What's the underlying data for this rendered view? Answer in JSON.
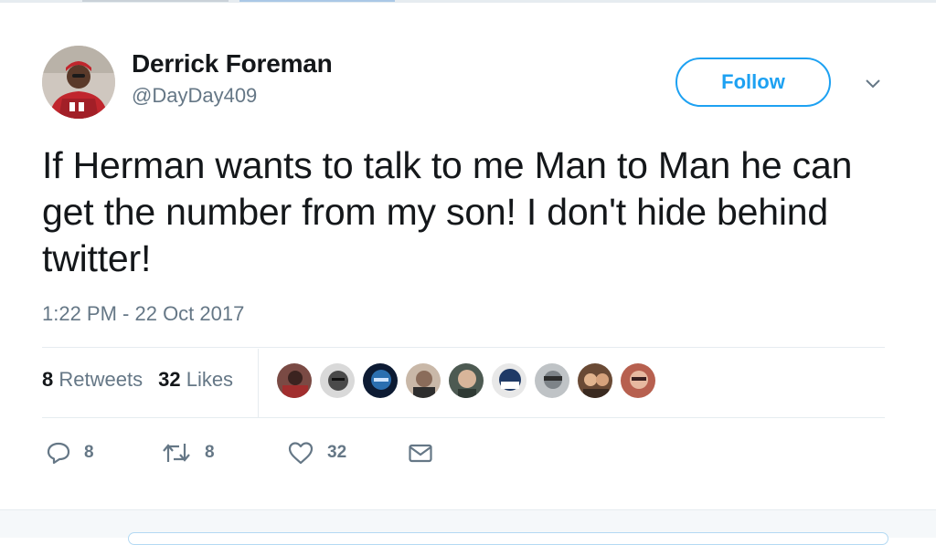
{
  "colors": {
    "accent": "#1da1f2",
    "text_primary": "#14171a",
    "text_secondary": "#657786",
    "divider": "#e6ecf0"
  },
  "tweet": {
    "author": {
      "display_name": "Derrick Foreman",
      "handle": "@DayDay409",
      "avatar": "avatar-photo"
    },
    "follow_label": "Follow",
    "menu_icon": "chevron-down-icon",
    "text": "If Herman wants to talk to me Man to Man he can get the number from my son! I don't hide behind twitter!",
    "timestamp": "1:22 PM - 22 Oct 2017",
    "stats": {
      "retweets_count": "8",
      "retweets_label": "Retweets",
      "likes_count": "32",
      "likes_label": "Likes"
    },
    "likers": [
      {
        "name": "liker-avatar-1",
        "color": "#7a4a44"
      },
      {
        "name": "liker-avatar-2",
        "color": "#6b6b6b"
      },
      {
        "name": "liker-avatar-3",
        "color": "#2b6fb0"
      },
      {
        "name": "liker-avatar-4",
        "color": "#8a6c5a"
      },
      {
        "name": "liker-avatar-5",
        "color": "#4d5a52"
      },
      {
        "name": "liker-avatar-6",
        "color": "#1f3a66"
      },
      {
        "name": "liker-avatar-7",
        "color": "#9aa1a6"
      },
      {
        "name": "liker-avatar-8",
        "color": "#b6825a"
      },
      {
        "name": "liker-avatar-9",
        "color": "#b7604f"
      }
    ],
    "actions": {
      "reply_icon": "reply-icon",
      "reply_count": "8",
      "retweet_icon": "retweet-icon",
      "retweet_count": "8",
      "like_icon": "heart-icon",
      "like_count": "32",
      "dm_icon": "envelope-icon"
    }
  }
}
